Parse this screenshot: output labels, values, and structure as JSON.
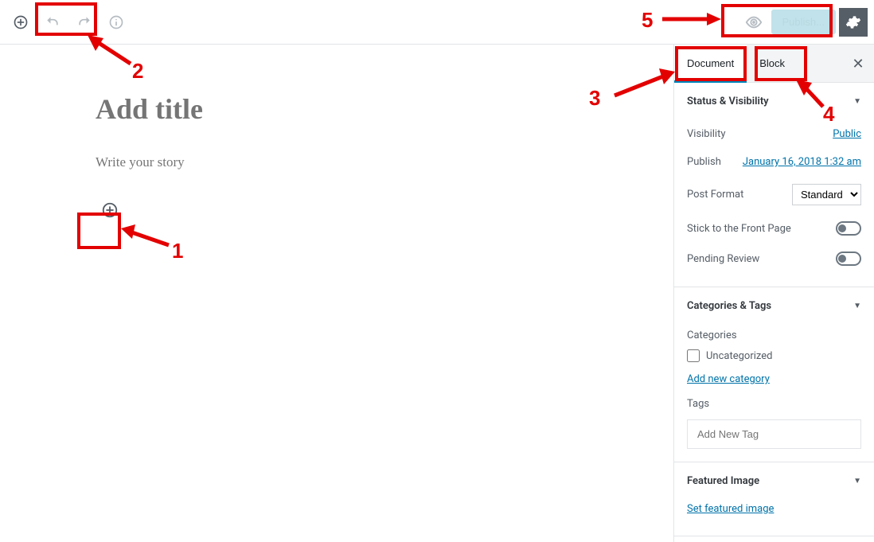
{
  "toolbar": {
    "publish_label": "Publish..."
  },
  "editor": {
    "title_placeholder": "Add title",
    "story_placeholder": "Write your story"
  },
  "sidebar": {
    "tabs": {
      "document": "Document",
      "block": "Block"
    },
    "panels": {
      "status": {
        "title": "Status & Visibility",
        "visibility_label": "Visibility",
        "visibility_value": "Public",
        "publish_label": "Publish",
        "publish_value": "January 16, 2018 1:32 am",
        "format_label": "Post Format",
        "format_value": "Standard",
        "stick_label": "Stick to the Front Page",
        "pending_label": "Pending Review"
      },
      "cats": {
        "title": "Categories & Tags",
        "categories_label": "Categories",
        "uncategorized": "Uncategorized",
        "add_category": "Add new category",
        "tags_label": "Tags",
        "tag_placeholder": "Add New Tag"
      },
      "featured": {
        "title": "Featured Image",
        "set_link": "Set featured image"
      }
    }
  },
  "annotations": {
    "n1": "1",
    "n2": "2",
    "n3": "3",
    "n4": "4",
    "n5": "5"
  }
}
